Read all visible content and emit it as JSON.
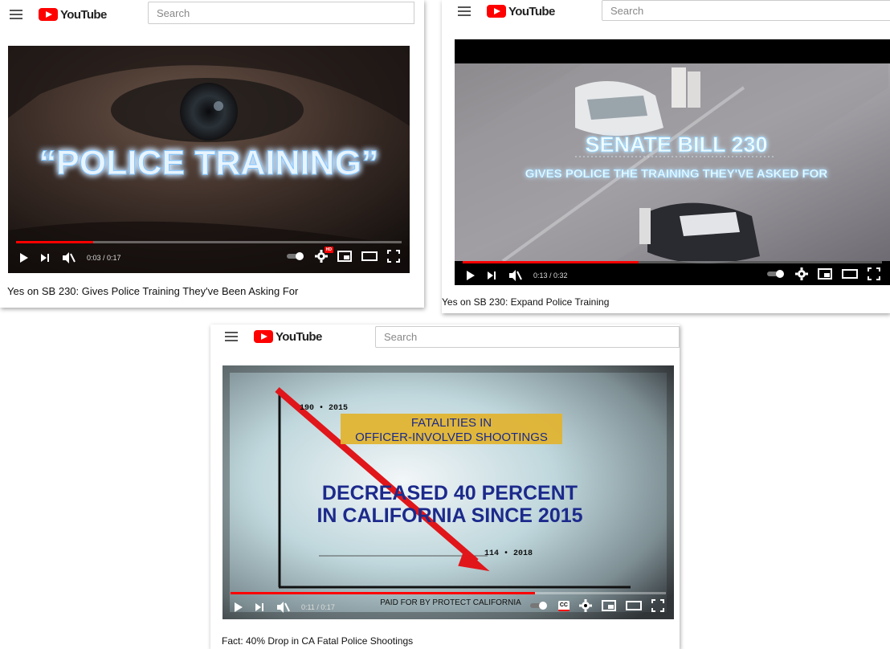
{
  "colors": {
    "brand_red": "#ff0000",
    "progress_red": "#ff0000",
    "player_bg": "#000000"
  },
  "cards": [
    {
      "logo_text": "YouTube",
      "search_placeholder": "Search",
      "video_caption": "“POLICE TRAINING”",
      "time": "0:03 / 0:17",
      "progress": 0.2,
      "settings_badge": "HD",
      "title": "Yes on SB 230: Gives Police Training They've Been Asking For"
    },
    {
      "logo_text": "YouTube",
      "search_placeholder": "Search",
      "video_caption_line1": "SENATE BILL 230",
      "video_caption_line2": "GIVES POLICE THE TRAINING THEY'VE ASKED FOR",
      "time": "0:13 / 0:32",
      "progress": 0.42,
      "title": "Yes on SB 230: Expand Police Training"
    },
    {
      "logo_text": "YouTube",
      "search_placeholder": "Search",
      "graph_start_label": "190 • 2015",
      "graph_end_label": "114 • 2018",
      "banner_line1": "FATALITIES IN",
      "banner_line2": "OFFICER-INVOLVED SHOOTINGS",
      "headline_line1": "DECREASED 40 PERCENT",
      "headline_line2": "IN CALIFORNIA SINCE 2015",
      "paid_for": "PAID FOR BY PROTECT CALIFORNIA",
      "time": "0:11 / 0:17",
      "progress": 0.7,
      "cc_label": "CC",
      "title": "Fact: 40% Drop in CA Fatal Police Shootings"
    }
  ]
}
